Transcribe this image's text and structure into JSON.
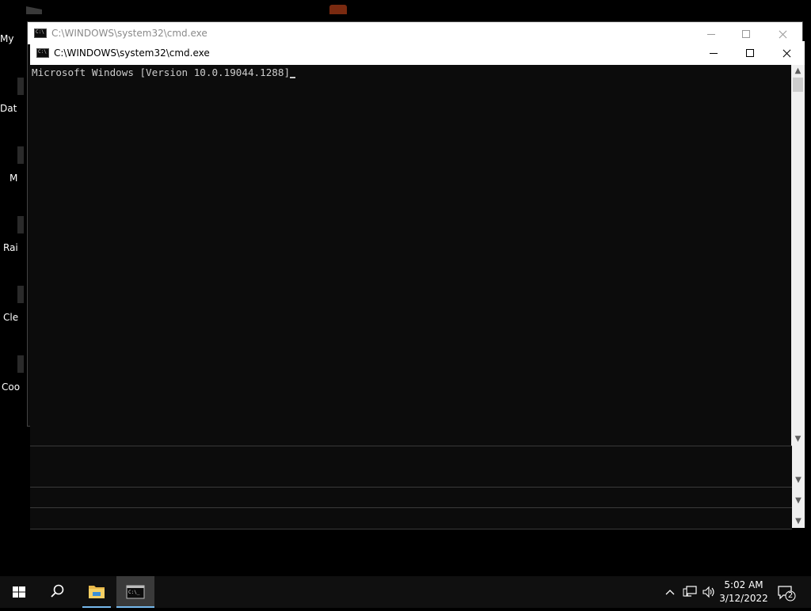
{
  "desktop": {
    "icons": [
      {
        "label": "My"
      },
      {
        "label": "Dat"
      },
      {
        "label": "M"
      },
      {
        "label": "Rai"
      },
      {
        "label": "Cle"
      },
      {
        "label": "Coo"
      }
    ]
  },
  "back_window": {
    "title": "C:\\WINDOWS\\system32\\cmd.exe"
  },
  "front_window": {
    "title": "C:\\WINDOWS\\system32\\cmd.exe",
    "console_line": "Microsoft Windows [Version 10.0.19044.1288]"
  },
  "taskbar": {
    "time": "5:02 AM",
    "date": "3/12/2022",
    "notification_count": "2",
    "icons": [
      "windows-start-icon",
      "search-icon",
      "file-explorer-icon",
      "cmd-icon"
    ],
    "tray_icons": [
      "chevron-up-icon",
      "network-icon",
      "volume-icon",
      "action-center-icon"
    ]
  }
}
